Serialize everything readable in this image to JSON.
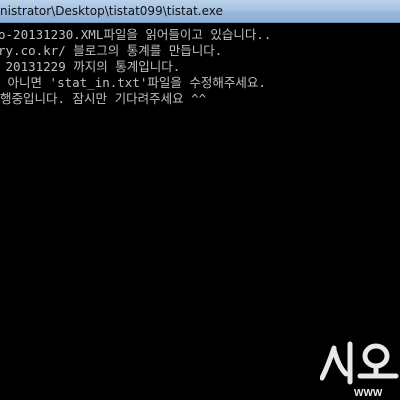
{
  "window": {
    "title": "nistrator\\Desktop\\tistat099\\tistat.exe"
  },
  "console": {
    "lines": [
      "o-20131230.XML파일을 읽어들이고 있습니다..",
      "ry.co.kr/ 블로그의 통계를 만듭니다.",
      " 20131229 까지의 통계입니다.",
      " 아니면 'stat_in.txt'파일을 수정해주세요.",
      "행중입니다. 잠시만 기다려주세요 ^^"
    ]
  },
  "watermark": {
    "logo_text": "시오",
    "url_fragment": "WWW"
  },
  "colors": {
    "console_background": "#000000",
    "console_text": "#c0c0c0",
    "titlebar": "#a6c3e2"
  },
  "icons": {
    "watermark": "sio-logo-icon"
  }
}
